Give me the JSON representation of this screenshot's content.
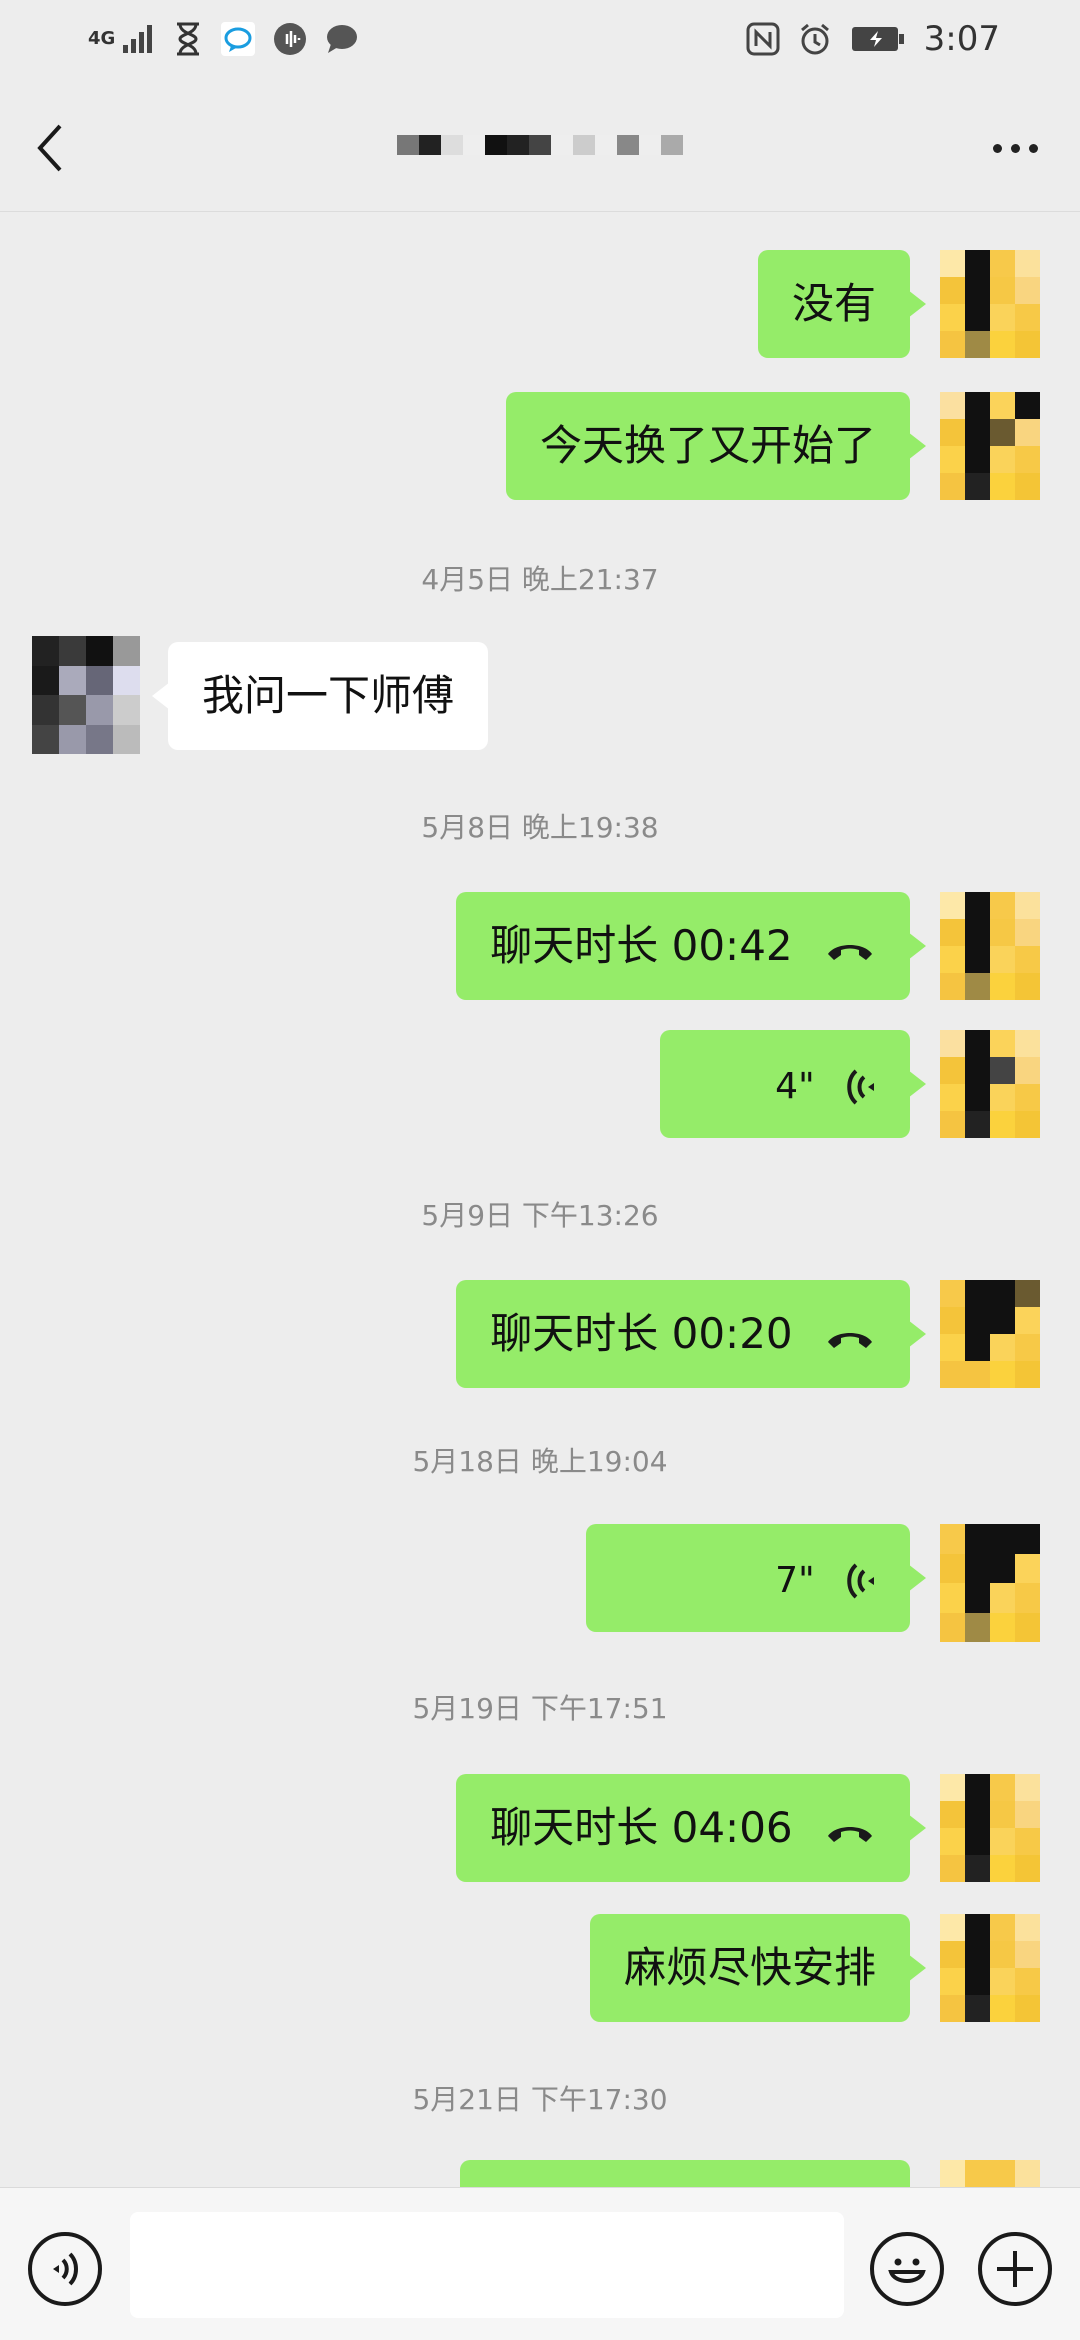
{
  "status_bar": {
    "network": "4G",
    "time": "3:07",
    "icons": [
      "signal-icon",
      "hourglass-icon",
      "chat-app-icon",
      "sound-app-icon",
      "message-icon",
      "nfc-icon",
      "alarm-icon",
      "battery-charging-icon"
    ]
  },
  "header": {
    "title_obscured": true,
    "icons": [
      "back-arrow-icon",
      "more-dots-icon"
    ]
  },
  "messages": [
    {
      "type": "text",
      "from": "me",
      "text": "没有"
    },
    {
      "type": "text",
      "from": "me",
      "text": "今天换了又开始了"
    },
    {
      "type": "time",
      "text": "4月5日 晚上21:37"
    },
    {
      "type": "text",
      "from": "other",
      "text": "我问一下师傅"
    },
    {
      "type": "time",
      "text": "5月8日 晚上19:38"
    },
    {
      "type": "call",
      "from": "me",
      "text": "聊天时长 00:42"
    },
    {
      "type": "voice",
      "from": "me",
      "text": "4\""
    },
    {
      "type": "time",
      "text": "5月9日 下午13:26"
    },
    {
      "type": "call",
      "from": "me",
      "text": "聊天时长 00:20"
    },
    {
      "type": "time",
      "text": "5月18日 晚上19:04"
    },
    {
      "type": "voice",
      "from": "me",
      "text": "7\""
    },
    {
      "type": "time",
      "text": "5月19日 下午17:51"
    },
    {
      "type": "call",
      "from": "me",
      "text": "聊天时长 04:06"
    },
    {
      "type": "text",
      "from": "me",
      "text": "麻烦尽快安排"
    },
    {
      "type": "time",
      "text": "5月21日 下午17:30"
    }
  ],
  "input_bar": {
    "text_value": "",
    "icons": [
      "voice-input-icon",
      "emoji-icon",
      "plus-icon"
    ]
  },
  "colors": {
    "my_bubble": "#95ec69",
    "other_bubble": "#ffffff",
    "background": "#ededed",
    "timestamp_text": "#8a8a8a"
  }
}
